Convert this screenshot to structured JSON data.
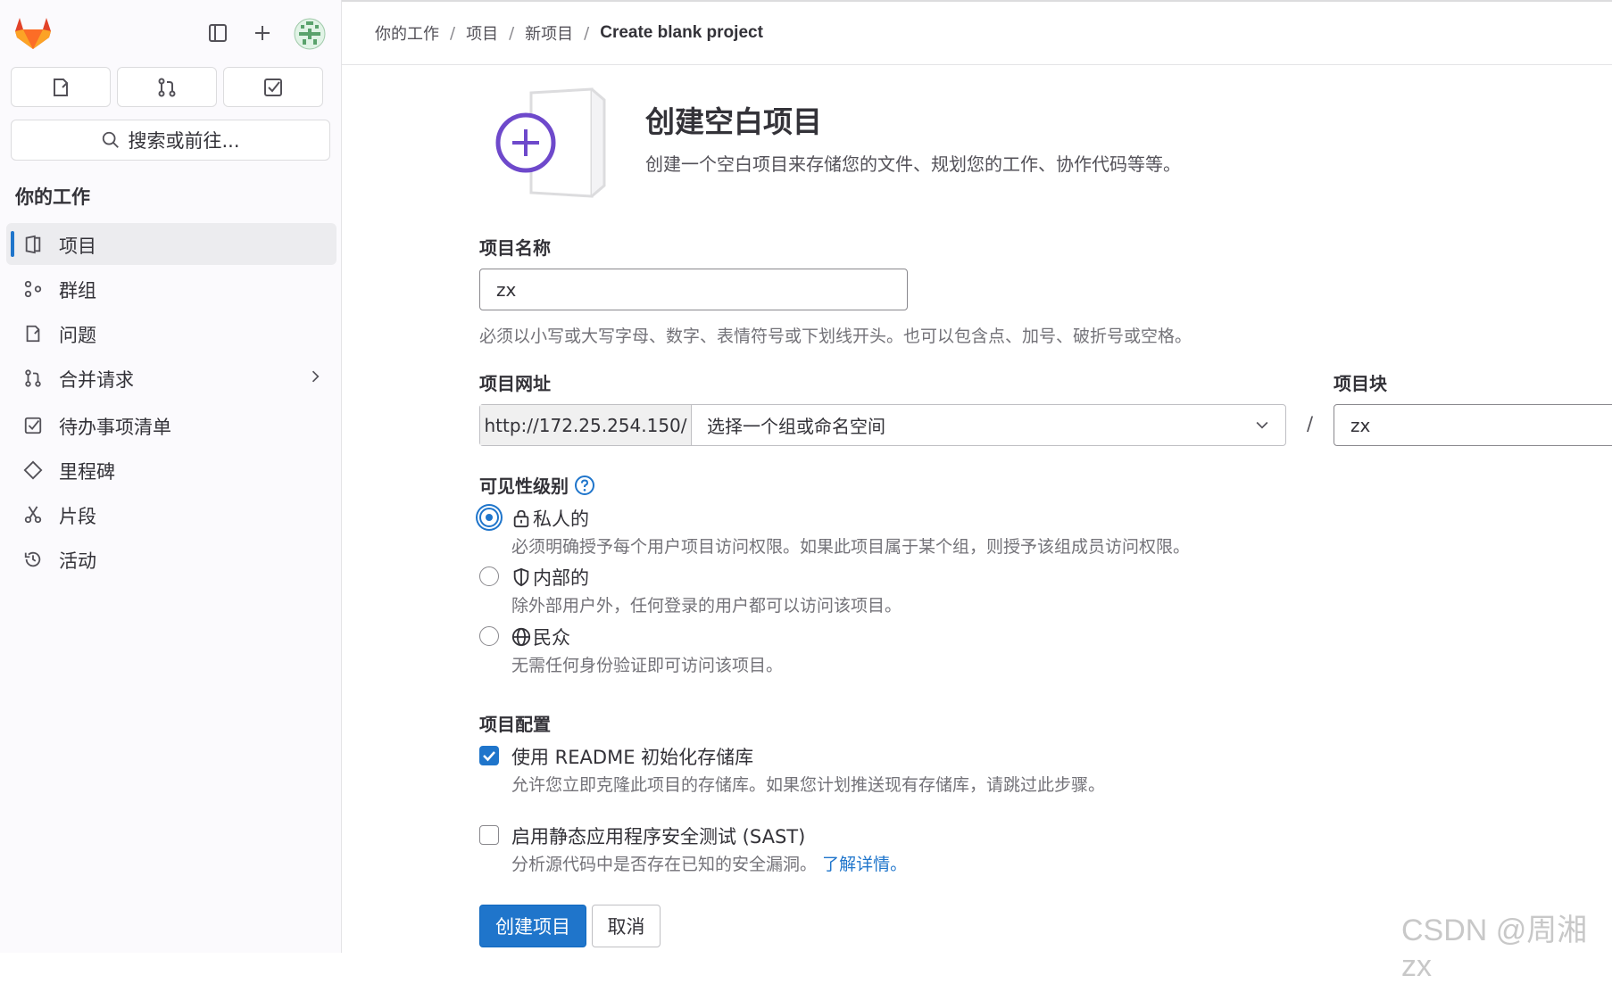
{
  "breadcrumb": {
    "items": [
      "你的工作",
      "项目",
      "新项目"
    ],
    "current": "Create blank project"
  },
  "sidebar": {
    "search_label": "搜索或前往...",
    "section_title": "你的工作",
    "items": [
      {
        "label": "项目",
        "icon": "project-icon",
        "active": true
      },
      {
        "label": "群组",
        "icon": "group-icon"
      },
      {
        "label": "问题",
        "icon": "issues-icon"
      },
      {
        "label": "合并请求",
        "icon": "merge-request-icon",
        "has_submenu": true
      },
      {
        "label": "待办事项清单",
        "icon": "todo-icon"
      },
      {
        "label": "里程碑",
        "icon": "milestone-icon"
      },
      {
        "label": "片段",
        "icon": "snippet-icon"
      },
      {
        "label": "活动",
        "icon": "history-icon"
      }
    ]
  },
  "page": {
    "title": "创建空白项目",
    "subtitle": "创建一个空白项目来存储您的文件、规划您的工作、协作代码等等。"
  },
  "form": {
    "name_label": "项目名称",
    "name_value": "zx",
    "name_help": "必须以小写或大写字母、数字、表情符号或下划线开头。也可以包含点、加号、破折号或空格。",
    "url_label": "项目网址",
    "url_prefix": "http://172.25.254.150/",
    "namespace_placeholder": "选择一个组或命名空间",
    "url_separator": "/",
    "slug_label": "项目块",
    "slug_value": "zx",
    "visibility_label": "可见性级别",
    "visibility_options": [
      {
        "title": "私人的",
        "icon": "lock-icon",
        "desc": "必须明确授予每个用户项目访问权限。如果此项目属于某个组，则授予该组成员访问权限。",
        "selected": true
      },
      {
        "title": "内部的",
        "icon": "shield-icon",
        "desc": "除外部用户外，任何登录的用户都可以访问该项目。",
        "selected": false
      },
      {
        "title": "民众",
        "icon": "earth-icon",
        "desc": "无需任何身份验证即可访问该项目。",
        "selected": false
      }
    ],
    "config_label": "项目配置",
    "readme": {
      "label": "使用 README 初始化存储库",
      "desc": "允许您立即克隆此项目的存储库。如果您计划推送现有存储库，请跳过此步骤。",
      "checked": true
    },
    "sast": {
      "label": "启用静态应用程序安全测试 (SAST)",
      "desc": "分析源代码中是否存在已知的安全漏洞。",
      "link": "了解详情。",
      "checked": false
    },
    "submit_label": "创建项目",
    "cancel_label": "取消"
  },
  "watermark": "CSDN @周湘zx",
  "colors": {
    "accent": "#1f75cb",
    "sidebar_bg": "#fbfafd",
    "illustration": "#6e49cb"
  }
}
